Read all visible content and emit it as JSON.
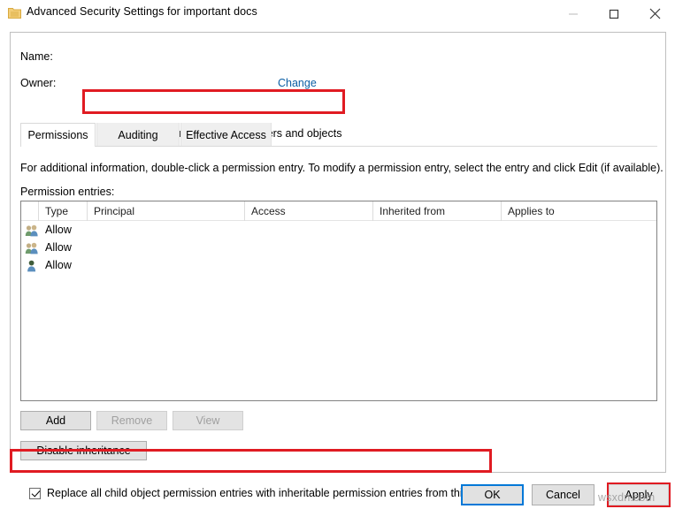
{
  "window": {
    "title": "Advanced Security Settings for important docs",
    "icon": "folder-security-icon",
    "minimize_label": "—",
    "maximize_label": "□",
    "close_label": "✕"
  },
  "header": {
    "name_label": "Name:",
    "name_value": "",
    "owner_label": "Owner:",
    "owner_value": "",
    "change_link": "Change",
    "replace_owner_checkbox": {
      "label": "Replace owner on subcontainers and objects",
      "checked": true,
      "highlighted": true
    }
  },
  "tabs": [
    {
      "label": "Permissions",
      "active": true
    },
    {
      "label": "Auditing",
      "active": false
    },
    {
      "label": "Effective Access",
      "active": false
    }
  ],
  "permissions": {
    "info_text": "For additional information, double-click a permission entry. To modify a permission entry, select the entry and click Edit (if available).",
    "entries_label": "Permission entries:",
    "columns": [
      "Type",
      "Principal",
      "Access",
      "Inherited from",
      "Applies to"
    ],
    "rows": [
      {
        "icon": "group-users-icon",
        "type": "Allow",
        "principal": "",
        "access": "",
        "inherited_from": "",
        "applies_to": ""
      },
      {
        "icon": "group-users-icon",
        "type": "Allow",
        "principal": "",
        "access": "",
        "inherited_from": "",
        "applies_to": ""
      },
      {
        "icon": "single-user-icon",
        "type": "Allow",
        "principal": "",
        "access": "",
        "inherited_from": "",
        "applies_to": ""
      }
    ],
    "buttons": {
      "add": "Add",
      "remove": "Remove",
      "view": "View",
      "disable_inheritance": "Disable inheritance"
    },
    "replace_all_checkbox": {
      "label": "Replace all child object permission entries with inheritable permission entries from this object",
      "checked": true,
      "highlighted": true
    }
  },
  "footer": {
    "ok": "OK",
    "cancel": "Cancel",
    "apply": "Apply",
    "apply_highlighted": true
  },
  "watermark": "wsxdn.com",
  "colors": {
    "highlight_red": "#e01b22",
    "link_blue": "#0b5fa5",
    "focus_blue": "#0078d7",
    "panel_border": "#bfbfbf",
    "listbox_border": "#828282"
  }
}
